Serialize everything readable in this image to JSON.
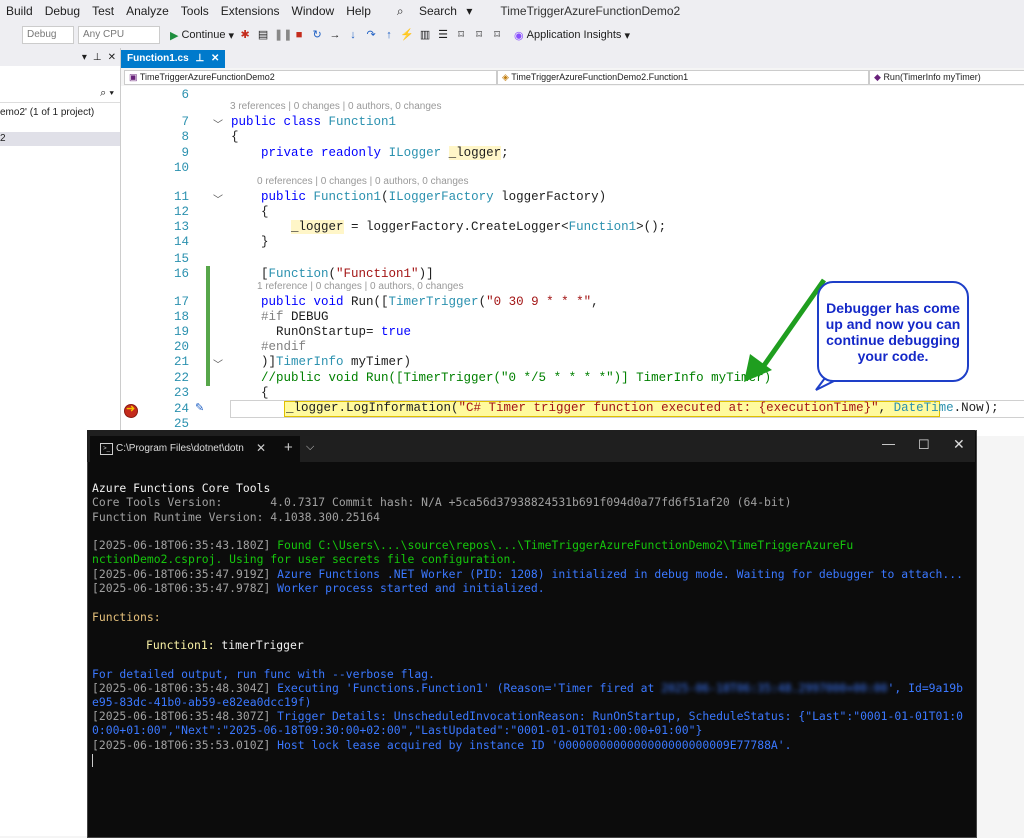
{
  "menu": [
    "Build",
    "Debug",
    "Test",
    "Analyze",
    "Tools",
    "Extensions",
    "Window",
    "Help"
  ],
  "search_label": "Search",
  "window_title": "TimeTriggerAzureFunctionDemo2",
  "toolbar": {
    "config": "Debug",
    "platform": "Any CPU",
    "continue_label": "Continue",
    "app_insights": "Application Insights"
  },
  "solution": {
    "item": "emo2' (1 of 1 project)",
    "selected": "2"
  },
  "editor": {
    "tab_label": "Function1.cs",
    "nav_project": "TimeTriggerAzureFunctionDemo2",
    "nav_class": "TimeTriggerAzureFunctionDemo2.Function1",
    "nav_member": "Run(TimerInfo myTimer)",
    "lens_class": "3 references | 0 changes | 0 authors, 0 changes",
    "lens_ctor": "0 references | 0 changes | 0 authors, 0 changes",
    "lens_run": "1 reference | 0 changes | 0 authors, 0 changes",
    "line_numbers": [
      "6",
      "7",
      "8",
      "9",
      "10",
      "11",
      "12",
      "13",
      "14",
      "15",
      "16",
      "17",
      "18",
      "19",
      "20",
      "21",
      "22",
      "23",
      "24",
      "25"
    ]
  },
  "callout": "Debugger has come up and now you can continue debugging your code.",
  "terminal": {
    "tab_title": "C:\\Program Files\\dotnet\\dotn",
    "lines": {
      "h1": "Azure Functions Core Tools",
      "h2": "Core Tools Version:       4.0.7317 Commit hash: N/A +5ca56d37938824531b691f094d0a77fd6f51af20 (64-bit)",
      "h3": "Function Runtime Version: 4.1038.300.25164",
      "l1_ts": "[2025-06-18T06:35:43.180Z]",
      "l1_a": " Found C:\\Users\\...\\source\\repos\\...\\",
      "l1_b": "TimeTriggerAzureFunctionDemo2\\TimeTriggerAzureFu",
      "l1_c": "nctionDemo2.csproj. Using for user secrets file configuration.",
      "l2_ts": "[2025-06-18T06:35:47.919Z]",
      "l2": " Azure Functions .NET Worker (PID: 1208) initialized in debug mode. Waiting for debugger to attach...",
      "l3_ts": "[2025-06-18T06:35:47.978Z]",
      "l3": " Worker process started and initialized.",
      "functions": "Functions:",
      "fn_name": "Function1:",
      "fn_type": " timerTrigger",
      "verbose": "For detailed output, run func with --verbose flag.",
      "l4_ts": "[2025-06-18T06:35:48.304Z]",
      "l4_a": " Executing 'Functions.Function1' (Reason='Timer fired at ",
      "l4_blur": "2025-06-18T06:35:48.2997000+00:00",
      "l4_b": "', Id=9a19b",
      "l4_c": "e95-83dc-41b0-ab59-e82ea0dcc19f)",
      "l5_ts": "[2025-06-18T06:35:48.307Z]",
      "l5_a": " Trigger Details: UnscheduledInvocationReason: RunOnStartup, ScheduleStatus: {\"Last\":\"0001-01-01T01:0",
      "l5_b": "0:00+01:00\",\"Next\":\"2025-06-18T09:30:00+02:00\",\"LastUpdated\":\"0001-01-01T01:00:00+01:00\"}",
      "l6_ts": "[2025-06-18T06:35:53.010Z]",
      "l6": " Host lock lease acquired by instance ID '0000000000000000000000009E77788A'."
    }
  }
}
